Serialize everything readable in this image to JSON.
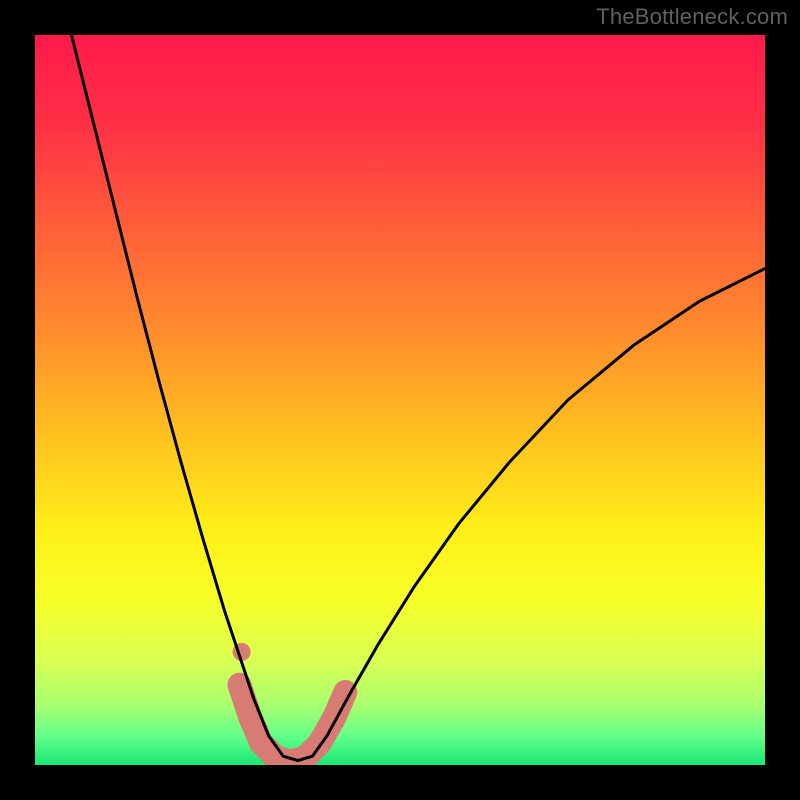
{
  "watermark": "TheBottleneck.com",
  "gradient": {
    "stops": [
      {
        "offset": 0.0,
        "color": "#ff1a4b"
      },
      {
        "offset": 0.12,
        "color": "#ff2f46"
      },
      {
        "offset": 0.25,
        "color": "#ff5a3a"
      },
      {
        "offset": 0.4,
        "color": "#ff8a2e"
      },
      {
        "offset": 0.55,
        "color": "#ffc11f"
      },
      {
        "offset": 0.68,
        "color": "#fff019"
      },
      {
        "offset": 0.78,
        "color": "#f6ff2a"
      },
      {
        "offset": 0.86,
        "color": "#d8ff54"
      },
      {
        "offset": 0.92,
        "color": "#a6ff70"
      },
      {
        "offset": 0.96,
        "color": "#63ff8a"
      },
      {
        "offset": 1.0,
        "color": "#18e873"
      }
    ]
  },
  "chart_data": {
    "type": "line",
    "title": "",
    "xlabel": "",
    "ylabel": "",
    "xlim": [
      0,
      1
    ],
    "ylim": [
      0,
      1
    ],
    "series": [
      {
        "name": "bottleneck-curve",
        "note": "Black V-shaped curve. y≈1 at x≈0.05, drops to ≈0 near x≈0.31–0.38, rises to ≈0.68 at x=1.",
        "x": [
          0.05,
          0.08,
          0.11,
          0.14,
          0.17,
          0.2,
          0.23,
          0.26,
          0.28,
          0.3,
          0.32,
          0.34,
          0.36,
          0.38,
          0.4,
          0.43,
          0.47,
          0.52,
          0.58,
          0.65,
          0.73,
          0.82,
          0.91,
          1.0
        ],
        "y": [
          1.0,
          0.88,
          0.76,
          0.64,
          0.525,
          0.415,
          0.31,
          0.21,
          0.15,
          0.09,
          0.04,
          0.012,
          0.006,
          0.012,
          0.04,
          0.095,
          0.165,
          0.245,
          0.33,
          0.415,
          0.5,
          0.575,
          0.635,
          0.68
        ]
      },
      {
        "name": "highlight-band",
        "note": "Thick salmon segment along the bottom of the V, roughly x 0.28–0.42.",
        "x": [
          0.28,
          0.295,
          0.31,
          0.33,
          0.35,
          0.37,
          0.39,
          0.41,
          0.425
        ],
        "y": [
          0.11,
          0.065,
          0.03,
          0.01,
          0.005,
          0.01,
          0.03,
          0.065,
          0.1
        ]
      },
      {
        "name": "highlight-dot",
        "note": "Small isolated salmon dot just above left end of highlight band.",
        "x": [
          0.283
        ],
        "y": [
          0.155
        ]
      }
    ],
    "colors": {
      "curve": "#000000",
      "highlight": "#d77b74"
    }
  }
}
